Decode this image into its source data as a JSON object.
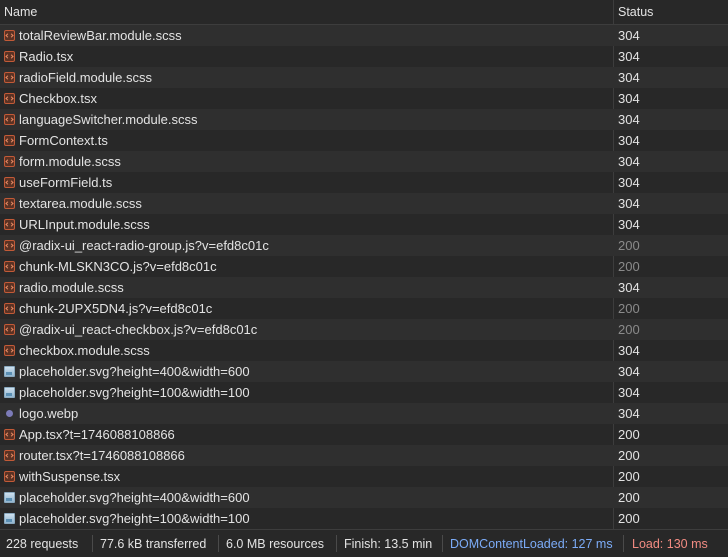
{
  "columns": {
    "name": "Name",
    "status": "Status"
  },
  "requests": [
    {
      "name": "totalReviewBar.module.scss",
      "status": "304",
      "icon": "script-icon"
    },
    {
      "name": "Radio.tsx",
      "status": "304",
      "icon": "script-icon"
    },
    {
      "name": "radioField.module.scss",
      "status": "304",
      "icon": "script-icon"
    },
    {
      "name": "Checkbox.tsx",
      "status": "304",
      "icon": "script-icon"
    },
    {
      "name": "languageSwitcher.module.scss",
      "status": "304",
      "icon": "script-icon"
    },
    {
      "name": "FormContext.ts",
      "status": "304",
      "icon": "script-icon"
    },
    {
      "name": "form.module.scss",
      "status": "304",
      "icon": "script-icon"
    },
    {
      "name": "useFormField.ts",
      "status": "304",
      "icon": "script-icon"
    },
    {
      "name": "textarea.module.scss",
      "status": "304",
      "icon": "script-icon"
    },
    {
      "name": "URLInput.module.scss",
      "status": "304",
      "icon": "script-icon"
    },
    {
      "name": "@radix-ui_react-radio-group.js?v=efd8c01c",
      "status": "200",
      "icon": "script-icon",
      "dim": true
    },
    {
      "name": "chunk-MLSKN3CO.js?v=efd8c01c",
      "status": "200",
      "icon": "script-icon",
      "dim": true
    },
    {
      "name": "radio.module.scss",
      "status": "304",
      "icon": "script-icon"
    },
    {
      "name": "chunk-2UPX5DN4.js?v=efd8c01c",
      "status": "200",
      "icon": "script-icon",
      "dim": true
    },
    {
      "name": "@radix-ui_react-checkbox.js?v=efd8c01c",
      "status": "200",
      "icon": "script-icon",
      "dim": true
    },
    {
      "name": "checkbox.module.scss",
      "status": "304",
      "icon": "script-icon"
    },
    {
      "name": "placeholder.svg?height=400&width=600",
      "status": "304",
      "icon": "image-icon"
    },
    {
      "name": "placeholder.svg?height=100&width=100",
      "status": "304",
      "icon": "image-icon"
    },
    {
      "name": "logo.webp",
      "status": "304",
      "icon": "webp-image-icon"
    },
    {
      "name": "App.tsx?t=1746088108866",
      "status": "200",
      "icon": "script-icon"
    },
    {
      "name": "router.tsx?t=1746088108866",
      "status": "200",
      "icon": "script-icon"
    },
    {
      "name": "withSuspense.tsx",
      "status": "200",
      "icon": "script-icon"
    },
    {
      "name": "placeholder.svg?height=400&width=600",
      "status": "200",
      "icon": "image-icon"
    },
    {
      "name": "placeholder.svg?height=100&width=100",
      "status": "200",
      "icon": "image-icon"
    }
  ],
  "summary": {
    "requests": "228 requests",
    "transferred": "77.6 kB transferred",
    "resources": "6.0 MB resources",
    "finish": "Finish: 13.5 min",
    "dom_content_loaded": "DOMContentLoaded: 127 ms",
    "load": "Load: 130 ms"
  },
  "colors": {
    "background": "#282828",
    "row_alt": "#2f2f2f",
    "dom_content_loaded": "#7cacf8",
    "load": "#f28b82",
    "dim_status": "#8a8a8a"
  }
}
